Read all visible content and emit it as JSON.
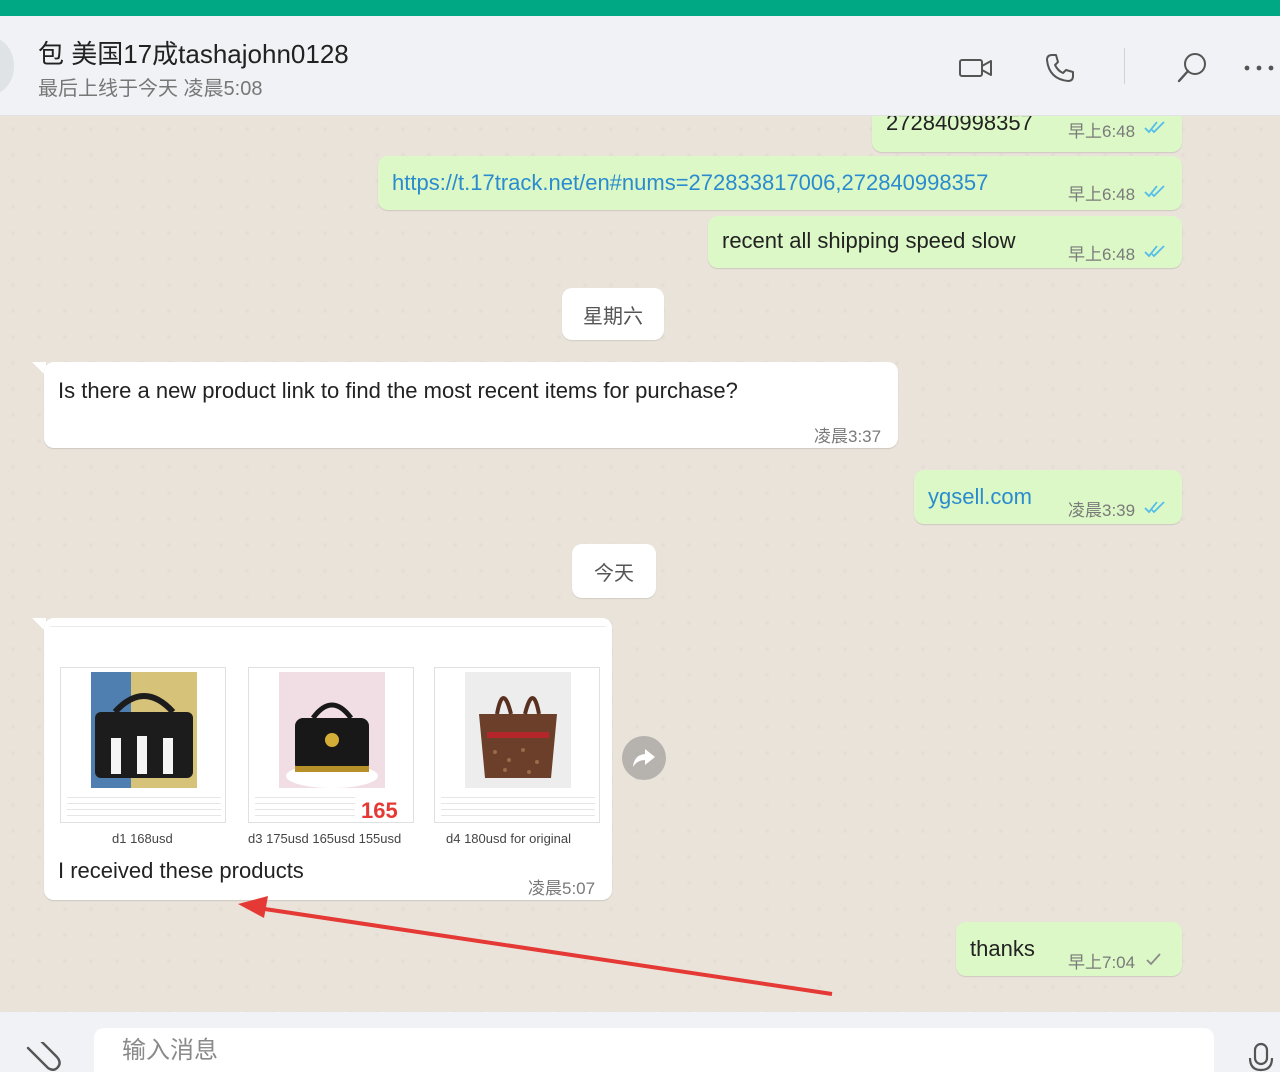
{
  "header": {
    "contact_name": "包 美国17成tashajohn0128",
    "status": "最后上线于今天 凌晨5:08",
    "icons": [
      "video-call-icon",
      "voice-call-icon",
      "search-icon",
      "more-icon"
    ]
  },
  "messages": [
    {
      "direction": "out",
      "text": "272840998357",
      "time": "早上6:48",
      "status": "read"
    },
    {
      "direction": "out",
      "text": "https://t.17track.net/en#nums=272833817006,272840998357",
      "time": "早上6:48",
      "status": "read"
    },
    {
      "direction": "out",
      "text": "recent all shipping speed slow",
      "time": "早上6:48",
      "status": "read"
    },
    {
      "direction": "in",
      "text": "Is there a new product link to find the most recent items for purchase?",
      "time": "凌晨3:37"
    },
    {
      "direction": "out",
      "text": "ygsell.com",
      "time": "凌晨3:39",
      "status": "read"
    },
    {
      "direction": "in",
      "text": "I received these products",
      "time": "凌晨5:07"
    },
    {
      "direction": "out",
      "text": "thanks",
      "time": "早上7:04",
      "status": "sent"
    }
  ],
  "date_separators": [
    "星期六",
    "今天"
  ],
  "products": [
    {
      "caption": "d1 168usd"
    },
    {
      "caption": "d3 175usd 165usd 155usd",
      "price_tag": "165"
    },
    {
      "caption": "d4 180usd for original"
    }
  ],
  "colors": {
    "accent": "#00a884",
    "outgoing_bubble": "#dcf8c6",
    "incoming_bubble": "#ffffff",
    "read_ticks": "#53bdeb",
    "link": "#2a8ccf",
    "annotation_arrow": "#e53935"
  },
  "composer": {
    "placeholder": "输入消息",
    "icons": [
      "paperclip-icon",
      "microphone-icon"
    ]
  }
}
